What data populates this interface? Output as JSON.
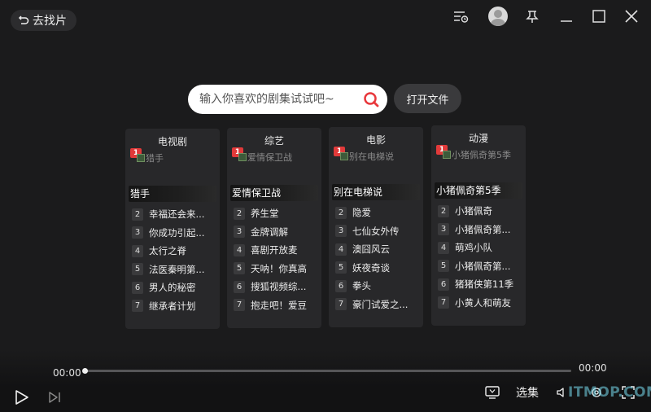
{
  "topbar": {
    "back_label": "去找片"
  },
  "search": {
    "placeholder": "输入你喜欢的剧集试试吧~",
    "open_file_label": "打开文件"
  },
  "categories": [
    {
      "title": "电视剧",
      "badge": "1",
      "thumb_alt": "猎手",
      "featured": "猎手",
      "items": [
        {
          "rank": "2",
          "name": "幸福还会来..."
        },
        {
          "rank": "3",
          "name": "你成功引起..."
        },
        {
          "rank": "4",
          "name": "太行之脊"
        },
        {
          "rank": "5",
          "name": "法医秦明第..."
        },
        {
          "rank": "6",
          "name": "男人的秘密"
        },
        {
          "rank": "7",
          "name": "继承者计划"
        }
      ]
    },
    {
      "title": "综艺",
      "badge": "1",
      "thumb_alt": "爱情保卫战",
      "featured": "爱情保卫战",
      "items": [
        {
          "rank": "2",
          "name": "养生堂"
        },
        {
          "rank": "3",
          "name": "金牌调解"
        },
        {
          "rank": "4",
          "name": "喜剧开放麦"
        },
        {
          "rank": "5",
          "name": "天呐！你真高"
        },
        {
          "rank": "6",
          "name": "搜狐视频综..."
        },
        {
          "rank": "7",
          "name": "抱走吧！爱豆"
        }
      ]
    },
    {
      "title": "电影",
      "badge": "1",
      "thumb_alt": "别在电梯说",
      "featured": "别在电梯说",
      "items": [
        {
          "rank": "2",
          "name": "隐爱"
        },
        {
          "rank": "3",
          "name": "七仙女外传"
        },
        {
          "rank": "4",
          "name": "澳囧风云"
        },
        {
          "rank": "5",
          "name": "妖夜奇谈"
        },
        {
          "rank": "6",
          "name": "拳头"
        },
        {
          "rank": "7",
          "name": "豪门试爱之..."
        }
      ]
    },
    {
      "title": "动漫",
      "badge": "1",
      "thumb_alt": "小猪佩奇第5季",
      "featured": "小猪佩奇第5季",
      "items": [
        {
          "rank": "2",
          "name": "小猪佩奇"
        },
        {
          "rank": "3",
          "name": "小猪佩奇第..."
        },
        {
          "rank": "4",
          "name": "萌鸡小队"
        },
        {
          "rank": "5",
          "name": "小猪佩奇第..."
        },
        {
          "rank": "6",
          "name": "猪猪侠第11季"
        },
        {
          "rank": "7",
          "name": "小黄人和萌友"
        }
      ]
    }
  ],
  "player": {
    "current_time": "00:00",
    "total_time": "00:00",
    "progress": 0,
    "episodes_label": "选集",
    "watermark": "ITMOP.COM"
  }
}
